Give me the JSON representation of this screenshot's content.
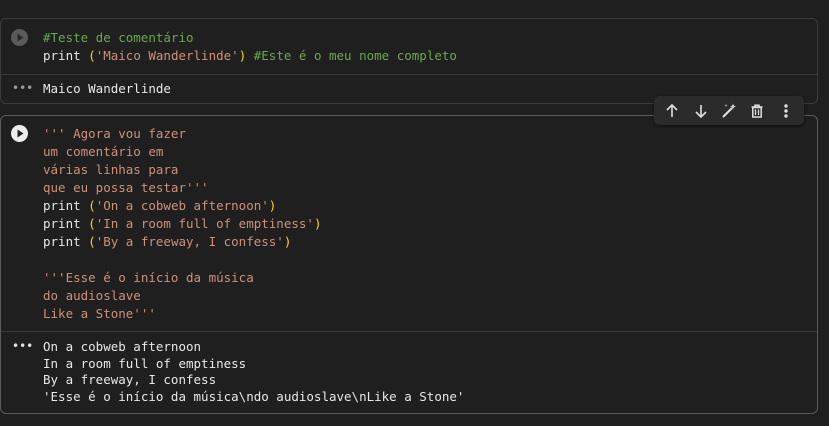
{
  "cells": [
    {
      "code_lines": [
        [
          {
            "t": "#Teste de comentário",
            "c": "comment"
          }
        ],
        [
          {
            "t": "print ",
            "c": "kw"
          },
          {
            "t": "(",
            "c": "paren"
          },
          {
            "t": "'Maico Wanderlinde'",
            "c": "string"
          },
          {
            "t": ")",
            "c": "paren"
          },
          {
            "t": " #Este é o meu nome completo",
            "c": "comment"
          }
        ]
      ],
      "output_lines": [
        "Maico Wanderlinde"
      ]
    },
    {
      "code_lines": [
        [
          {
            "t": "''' Agora vou fazer",
            "c": "string"
          }
        ],
        [
          {
            "t": "um comentário em",
            "c": "string"
          }
        ],
        [
          {
            "t": "várias linhas para",
            "c": "string"
          }
        ],
        [
          {
            "t": "que eu possa testar'''",
            "c": "string"
          }
        ],
        [
          {
            "t": "print ",
            "c": "kw"
          },
          {
            "t": "(",
            "c": "paren"
          },
          {
            "t": "'On a cobweb afternoon'",
            "c": "string"
          },
          {
            "t": ")",
            "c": "paren"
          }
        ],
        [
          {
            "t": "print ",
            "c": "kw"
          },
          {
            "t": "(",
            "c": "paren"
          },
          {
            "t": "'In a room full of emptiness'",
            "c": "string"
          },
          {
            "t": ")",
            "c": "paren"
          }
        ],
        [
          {
            "t": "print ",
            "c": "kw"
          },
          {
            "t": "(",
            "c": "paren"
          },
          {
            "t": "'By a freeway, I confess'",
            "c": "string"
          },
          {
            "t": ")",
            "c": "paren"
          }
        ],
        [],
        [
          {
            "t": "'''Esse é o início da música",
            "c": "string"
          }
        ],
        [
          {
            "t": "do audioslave",
            "c": "string"
          }
        ],
        [
          {
            "t": "Like a Stone'''",
            "c": "string"
          }
        ]
      ],
      "output_lines": [
        "On a cobweb afternoon",
        "In a room full of emptiness",
        "By a freeway, I confess",
        "'Esse é o início da música\\ndo audioslave\\nLike a Stone'"
      ]
    }
  ],
  "toolbar": {
    "icons": [
      "arrow-up-icon",
      "arrow-down-icon",
      "magic-wand-icon",
      "trash-icon",
      "more-vert-icon"
    ]
  },
  "output_indicator": "•••",
  "colors": {
    "background": "#1f1f1f",
    "comment": "#6aa84f",
    "string": "#ce9178",
    "paren": "#ffd700",
    "text": "#d4d4d4"
  }
}
